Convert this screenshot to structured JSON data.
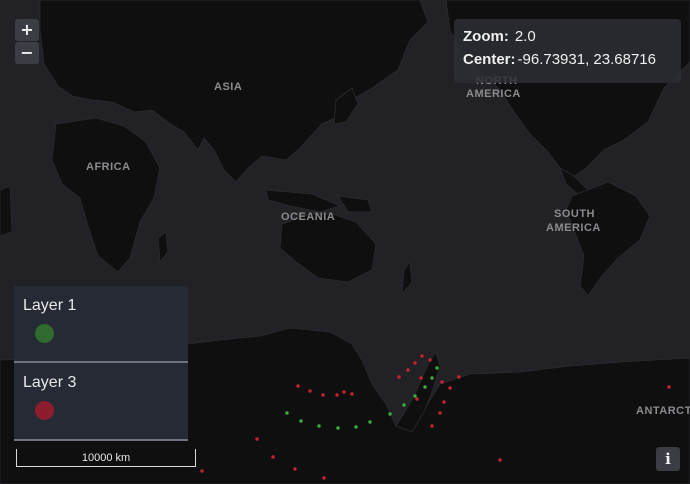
{
  "map": {
    "zoom_key": "Zoom:",
    "zoom_value": "2.0",
    "center_key": "Center:",
    "center_value": "-96.73931, 23.68716",
    "zoom_in": "+",
    "zoom_out": "−",
    "attribution_button": "i",
    "scale": "10000 km",
    "region_labels": {
      "asia": "ASIA",
      "africa": "AFRICA",
      "oceania": "OCEANIA",
      "north_america_1": "NORTH",
      "north_america_2": "AMERICA",
      "south_america_1": "SOUTH",
      "south_america_2": "AMERICA",
      "antarctica": "ANTARCT"
    }
  },
  "legend": [
    {
      "label": "Layer 1",
      "color": "#2f6a2e"
    },
    {
      "label": "Layer 3",
      "color": "#8c1c2e"
    }
  ],
  "colors": {
    "land": "#0f0f10",
    "ocean": "#222226",
    "layer1_points": "#3cad3c",
    "layer3_points": "#c8232d"
  }
}
